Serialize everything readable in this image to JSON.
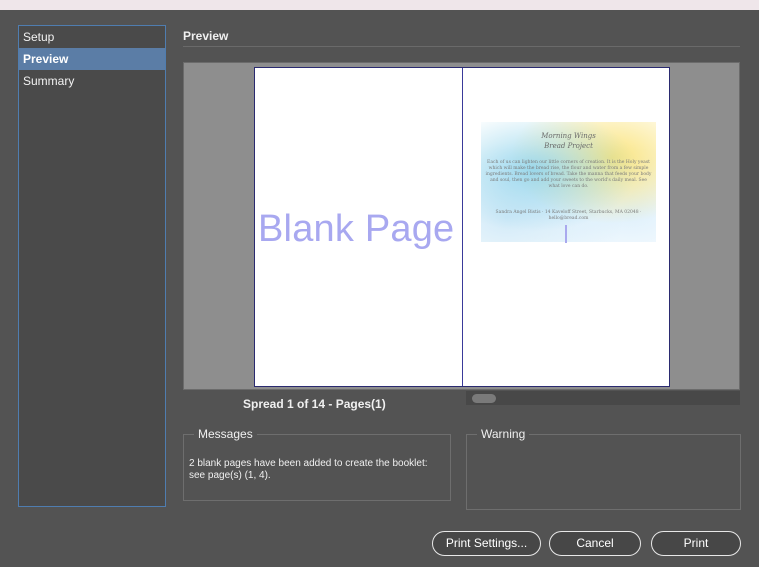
{
  "sidebar": {
    "items": [
      {
        "label": "Setup",
        "active": false
      },
      {
        "label": "Preview",
        "active": true
      },
      {
        "label": "Summary",
        "active": false
      }
    ]
  },
  "main": {
    "section_title": "Preview",
    "blank_page_label": "Blank Page",
    "page_art": {
      "title_line1": "Morning Wings",
      "title_line2": "Bread Project",
      "body": "Each of us can lighten our little corners of creation. It is the Holy yeast which will make the bread rise, the flour and water from a few simple ingredients. Bread lovers of bread. Take the manna that feeds your body and soul, then go and add your sweets to the world's daily meal. See what love can do.",
      "footer": "Sandra Angel Bistis · 14 Kaveloff Street, Starbucks, MA 02048 · hello@bread.com"
    },
    "spread_label": "Spread 1 of 14 - Pages(1)",
    "messages": {
      "title": "Messages",
      "text": "2 blank pages have been added to create the booklet: see page(s) (1, 4)."
    },
    "warning": {
      "title": "Warning",
      "text": ""
    }
  },
  "buttons": {
    "print_settings": "Print Settings...",
    "cancel": "Cancel",
    "print": "Print"
  },
  "colors": {
    "background": "#535353",
    "sidebar_active": "#5b7da6",
    "blank_page_text": "#a8a8f0",
    "spread_border": "#2a2a70"
  }
}
